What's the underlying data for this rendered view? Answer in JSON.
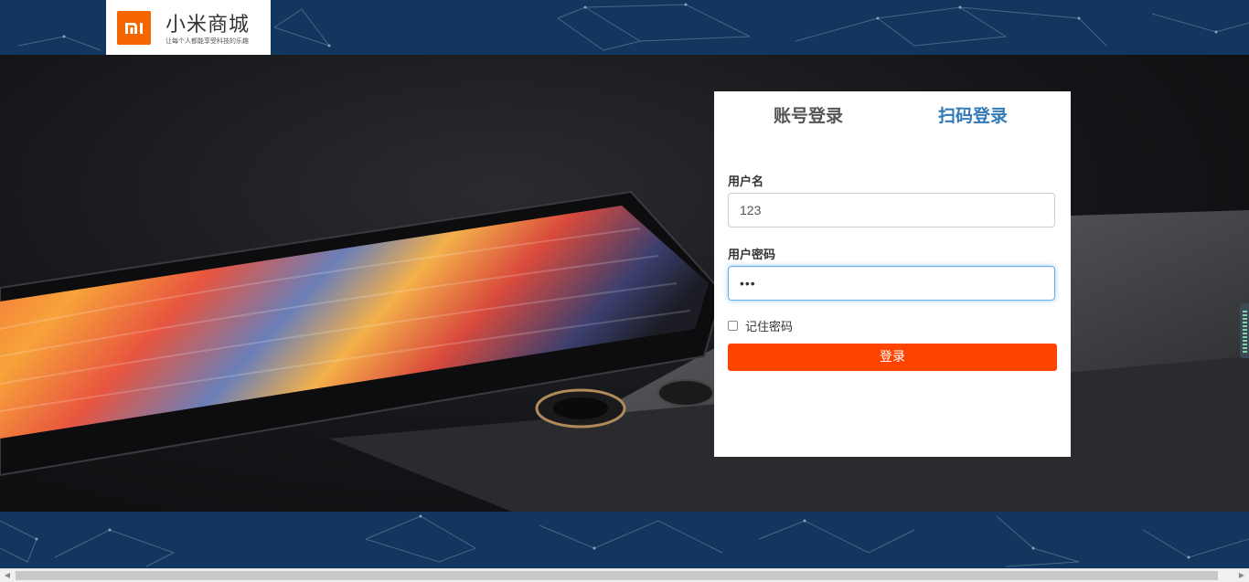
{
  "brand": {
    "logo_text": "mi",
    "title": "小米商城",
    "slogan": "让每个人都能享受科技的乐趣"
  },
  "login": {
    "tabs": [
      {
        "label": "账号登录",
        "active": false
      },
      {
        "label": "扫码登录",
        "active": true
      }
    ],
    "username_label": "用户名",
    "username_value": "123",
    "password_label": "用户密码",
    "password_value": "•••",
    "remember_label": "记住密码",
    "remember_checked": false,
    "submit_label": "登录"
  },
  "colors": {
    "brand_orange": "#f56600",
    "submit_bg": "#ff4400",
    "active_tab": "#337ab7",
    "banner_bg": "#12365e"
  }
}
